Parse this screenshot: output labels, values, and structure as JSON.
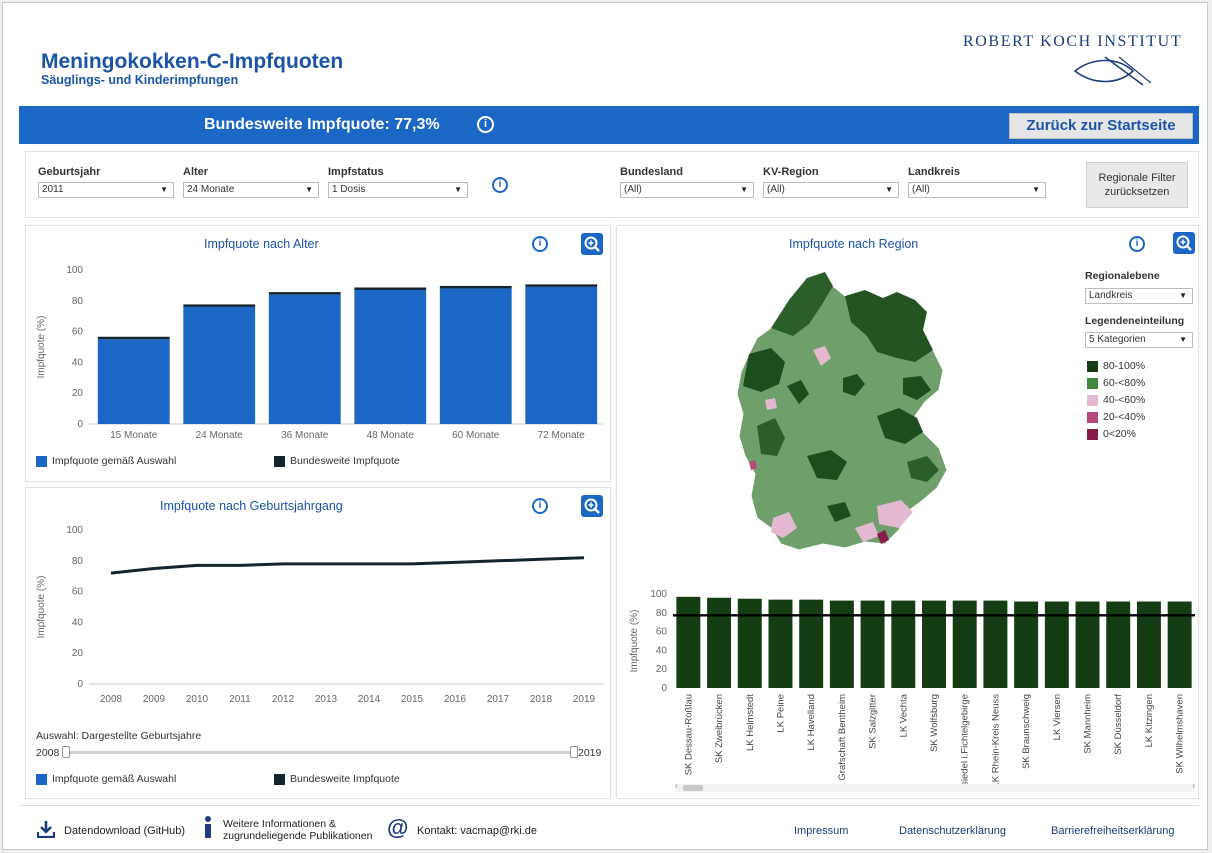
{
  "header": {
    "title": "Meningokokken-C-Impfquoten",
    "subtitle": "Säuglings- und Kinderimpfungen",
    "logo_text": "ROBERT KOCH INSTITUT"
  },
  "band": {
    "national_rate": "Bundesweite Impfquote: 77,3%",
    "back_button": "Zurück zur Startseite"
  },
  "filters": {
    "geburtsjahr": {
      "label": "Geburtsjahr",
      "value": "2011"
    },
    "alter": {
      "label": "Alter",
      "value": "24 Monate"
    },
    "impfstatus": {
      "label": "Impfstatus",
      "value": "1 Dosis"
    },
    "bundesland": {
      "label": "Bundesland",
      "value": "(All)"
    },
    "kv_region": {
      "label": "KV-Region",
      "value": "(All)"
    },
    "landkreis": {
      "label": "Landkreis",
      "value": "(All)"
    },
    "reset_button": "Regionale Filter zurücksetzen"
  },
  "age_panel": {
    "title": "Impfquote nach Alter",
    "legend_selection": "Impfquote gemäß Auswahl",
    "legend_national": "Bundesweite Impfquote"
  },
  "cohort_panel": {
    "title": "Impfquote nach Geburtsjahrgang",
    "selection_label": "Auswahl: Dargestellte Geburtsjahre",
    "slider_start": "2008",
    "slider_end": "2019",
    "legend_selection": "Impfquote gemäß Auswahl",
    "legend_national": "Bundesweite Impfquote"
  },
  "region_panel": {
    "title": "Impfquote nach Region",
    "level_label": "Regionalebene",
    "level_value": "Landkreis",
    "legend_label": "Legendeneinteilung",
    "legend_value": "5 Kategorien",
    "legend": [
      {
        "label": "80-100%",
        "color": "#143d14"
      },
      {
        "label": "60-<80%",
        "color": "#3f8a3f"
      },
      {
        "label": "40-<60%",
        "color": "#e4b8d0"
      },
      {
        "label": "20-<40%",
        "color": "#b5497e"
      },
      {
        "label": "0<20%",
        "color": "#8a1a48"
      }
    ]
  },
  "footer": {
    "download": "Datendownload (GitHub)",
    "info_line1": "Weitere Informationen &",
    "info_line2": "zugrundeliegende Publikationen",
    "contact": "Kontakt: vacmap@rki.de",
    "impressum": "Impressum",
    "privacy": "Datenschutzerklärung",
    "accessibility": "Barrierefreiheitserklärung"
  },
  "colors": {
    "accent": "#1a67c6",
    "title": "#1a55a8",
    "national": "#14252f",
    "region_bar": "#143d14"
  },
  "chart_data": [
    {
      "type": "bar",
      "title": "Impfquote nach Alter",
      "ylabel": "Impfquote (%)",
      "ylim": [
        0,
        100
      ],
      "yticks": [
        0,
        20,
        40,
        60,
        80,
        100
      ],
      "categories": [
        "15 Monate",
        "24 Monate",
        "36 Monate",
        "48 Monate",
        "60 Monate",
        "72 Monate"
      ],
      "series": [
        {
          "name": "Impfquote gemäß Auswahl",
          "values": [
            55,
            76,
            84,
            87,
            88,
            89
          ]
        },
        {
          "name": "Bundesweite Impfquote",
          "values": [
            56,
            77,
            85,
            88,
            89,
            90
          ]
        }
      ]
    },
    {
      "type": "line",
      "title": "Impfquote nach Geburtsjahrgang",
      "ylabel": "Impfquote (%)",
      "ylim": [
        0,
        100
      ],
      "yticks": [
        0,
        20,
        40,
        60,
        80,
        100
      ],
      "x": [
        2008,
        2009,
        2010,
        2011,
        2012,
        2013,
        2014,
        2015,
        2016,
        2017,
        2018,
        2019
      ],
      "series": [
        {
          "name": "Bundesweite Impfquote",
          "values": [
            72,
            75,
            77,
            77,
            78,
            78,
            78,
            78,
            79,
            80,
            81,
            82
          ]
        }
      ]
    },
    {
      "type": "bar",
      "ylabel": "Impfquote (%)",
      "ylim": [
        0,
        100
      ],
      "yticks": [
        0,
        20,
        40,
        60,
        80,
        100
      ],
      "reference_line": 77.3,
      "categories": [
        "SK Dessau-Roßlau",
        "SK Zweibrücken",
        "LK Helmstedt",
        "LK Peine",
        "LK Havelland",
        "LK Grafschaft Bentheim",
        "SK Salzgitter",
        "LK Vechta",
        "SK Wolfsburg",
        "LK Wunsiedel i.Fichtelgebirge",
        "LK Rhein-Kreis Neuss",
        "SK Braunschweig",
        "LK Viersen",
        "SK Mannheim",
        "SK Düsseldorf",
        "LK Kitzingen",
        "SK Wilhelmshaven"
      ],
      "values": [
        97,
        96,
        95,
        94,
        94,
        93,
        93,
        93,
        93,
        93,
        93,
        92,
        92,
        92,
        92,
        92,
        92
      ]
    }
  ]
}
